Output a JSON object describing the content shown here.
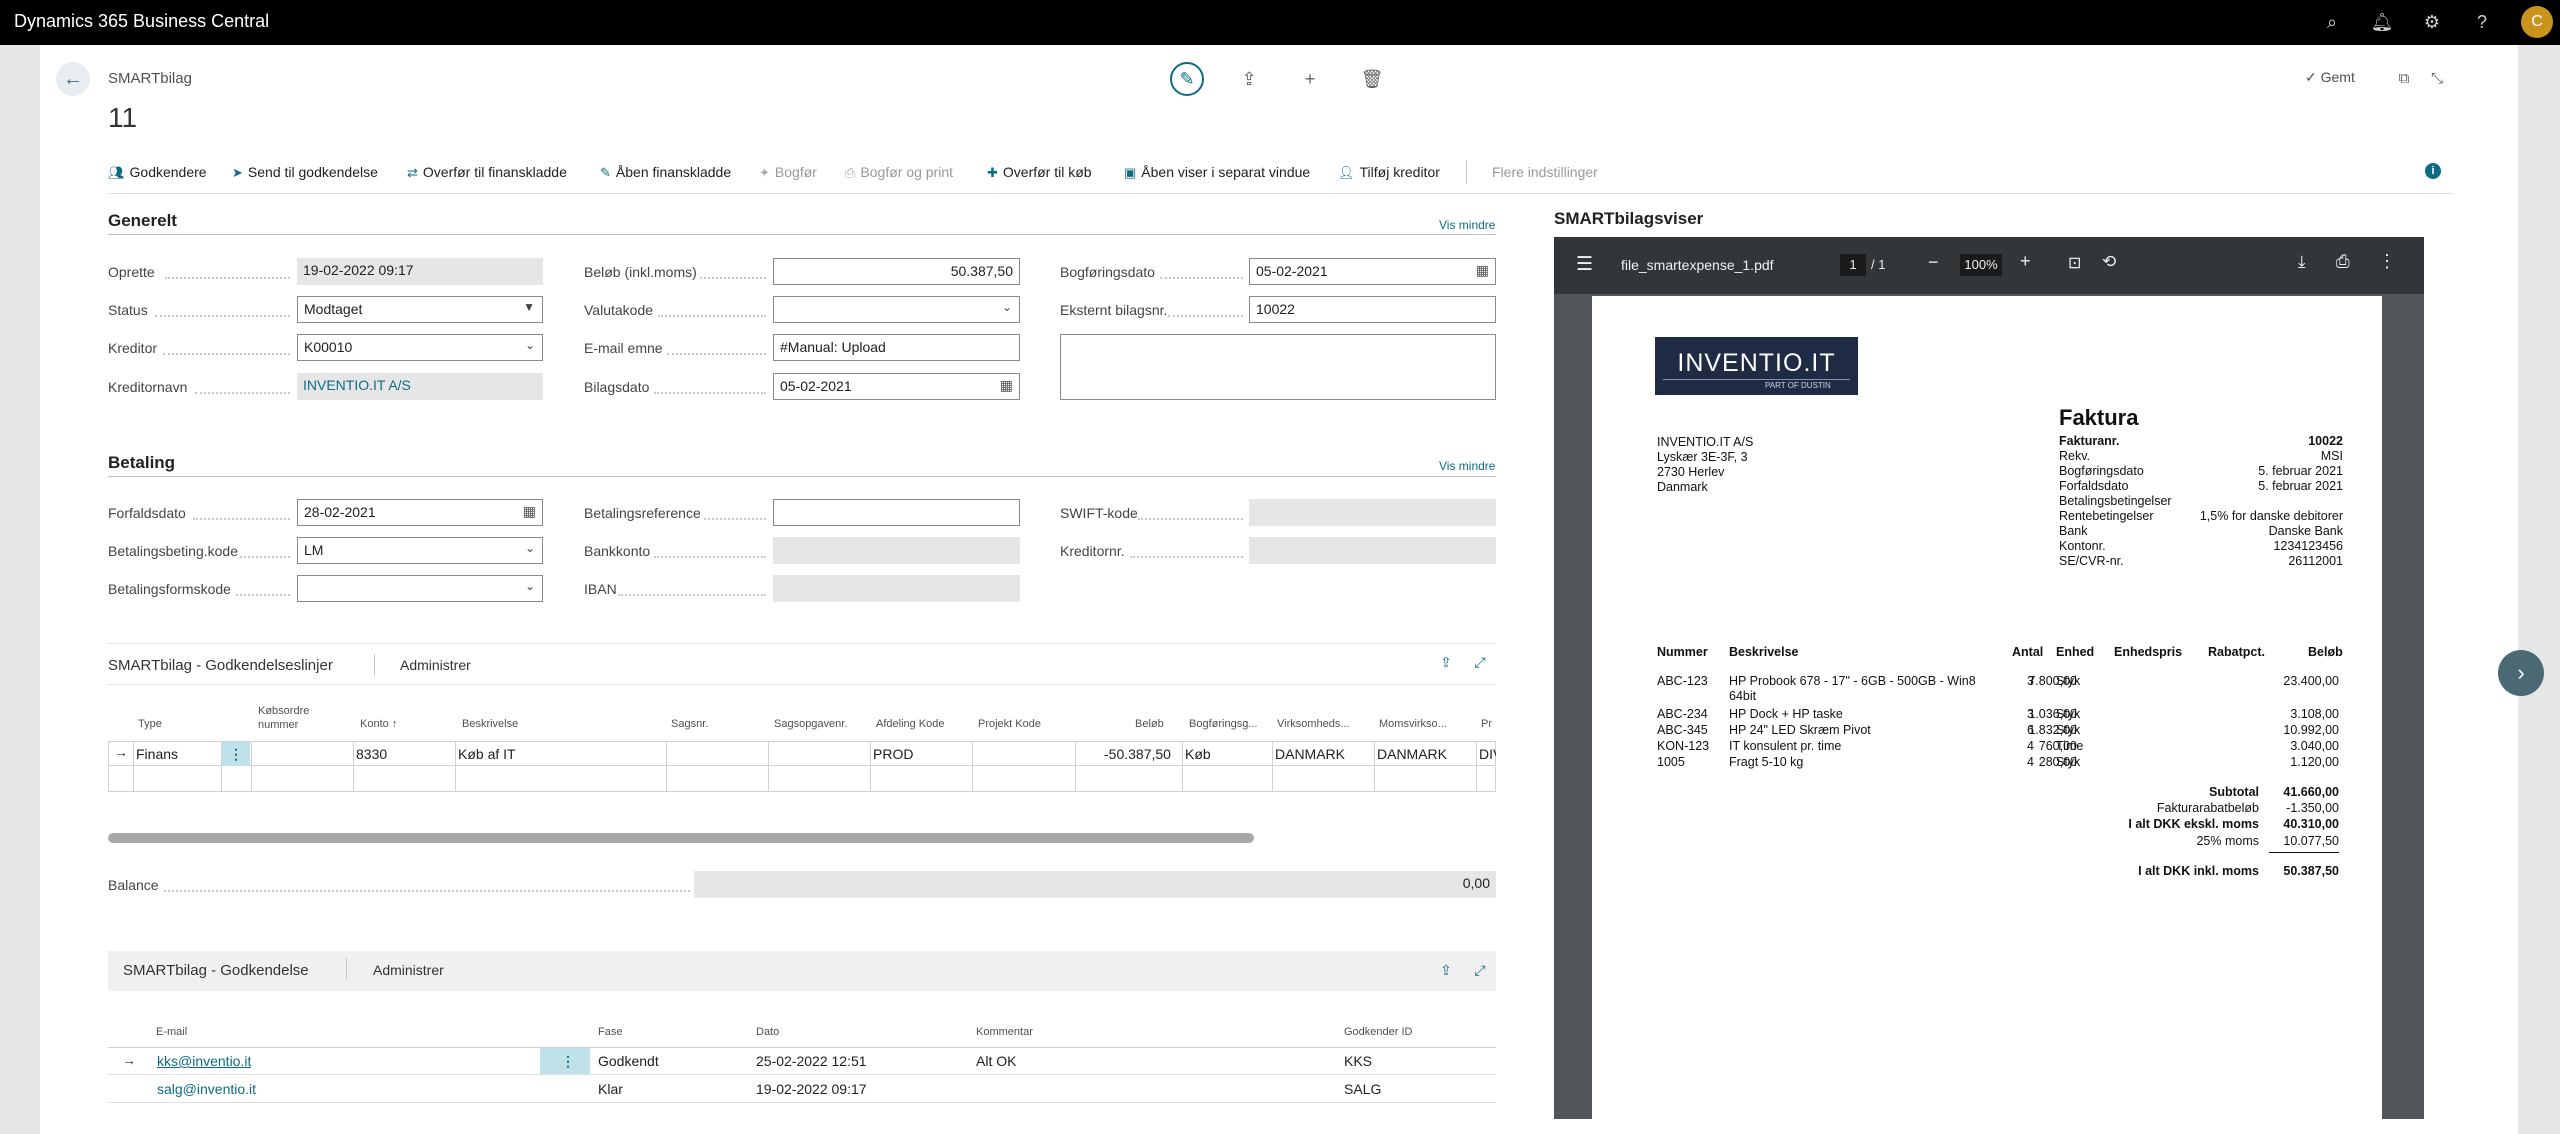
{
  "app": {
    "title": "Dynamics 365 Business Central",
    "avatar": "C",
    "icons": [
      "search-icon",
      "bell-icon",
      "gear-icon",
      "help-icon"
    ]
  },
  "header": {
    "caption": "SMARTbilag",
    "record": "11",
    "saved": "✓ Gemt"
  },
  "actions": [
    "Godkendere",
    "Send til godkendelse",
    "Overfør til finanskladde",
    "Åben finanskladde",
    "Bogfør",
    "Bogfør og print",
    "Overfør til køb",
    "Åben viser i separat vindue",
    "Tilføj kreditor",
    "Flere indstillinger"
  ],
  "generelt": {
    "title": "Generelt",
    "vis_mindre": "Vis mindre",
    "oprette_label": "Oprette",
    "oprette": "19-02-2022 09:17",
    "status_label": "Status",
    "status": "Modtaget",
    "kreditor_label": "Kreditor",
    "kreditor": "K00010",
    "kreditornavn_label": "Kreditornavn",
    "kreditornavn": "INVENTIO.IT A/S",
    "belob_label": "Beløb (inkl.moms)",
    "belob": "50.387,50",
    "valutakode_label": "Valutakode",
    "valutakode": "",
    "email_emne_label": "E-mail emne",
    "email_emne": "#Manual: Upload",
    "bilagsdato_label": "Bilagsdato",
    "bilagsdato": "05-02-2021",
    "bogforingsdato_label": "Bogføringsdato",
    "bogforingsdato": "05-02-2021",
    "eksternt_label": "Eksternt bilagsnr.",
    "eksternt": "10022"
  },
  "betaling": {
    "title": "Betaling",
    "vis_mindre": "Vis mindre",
    "forfaldsdato_label": "Forfaldsdato",
    "forfaldsdato": "28-02-2021",
    "betingelse_label": "Betalingsbeting.kode",
    "betingelse": "LM",
    "betalingsform_label": "Betalingsformskode",
    "betalingsform": "",
    "reference_label": "Betalingsreference",
    "reference": "",
    "bankkonto_label": "Bankkonto",
    "bankkonto": "",
    "iban_label": "IBAN",
    "iban": "",
    "swift_label": "SWIFT-kode",
    "swift": "",
    "kreditornr_label": "Kreditornr.",
    "kreditornr": ""
  },
  "lines": {
    "title": "SMARTbilag - Godkendelseslinjer",
    "manage": "Administrer",
    "headers": [
      "Type",
      "Købsordre nummer",
      "Konto ↑",
      "Beskrivelse",
      "Sagsnr.",
      "Sagsopgavenr.",
      "Afdeling Kode",
      "Projekt Kode",
      "Beløb",
      "Bogføringsg...",
      "Virksomheds...",
      "Momsvirkso...",
      "Pr"
    ],
    "row": [
      "Finans",
      "",
      "8330",
      "Køb af IT",
      "",
      "",
      "PROD",
      "",
      "-50.387,50",
      "Køb",
      "DANMARK",
      "DANMARK",
      "DIV"
    ],
    "balance_label": "Balance",
    "balance": "0,00"
  },
  "approval": {
    "title": "SMARTbilag - Godkendelse",
    "manage": "Administrer",
    "headers": [
      "E-mail",
      "Fase",
      "Dato",
      "Kommentar",
      "Godkender ID"
    ],
    "rows": [
      [
        "kks@inventio.it",
        "Godkendt",
        "25-02-2022 12:51",
        "Alt OK",
        "KKS"
      ],
      [
        "salg@inventio.it",
        "Klar",
        "19-02-2022 09:17",
        "",
        "SALG"
      ]
    ]
  },
  "viewer": {
    "title": "SMARTbilagsviser",
    "file": "file_smartexpense_1.pdf",
    "page": "1",
    "pages": "/  1",
    "zoom": "100%",
    "logo": "INVENTIO.IT",
    "logo_sub": "PART OF DUSTIN",
    "address": [
      "INVENTIO.IT A/S",
      "Lyskær 3E-3F, 3",
      "2730 Herlev",
      "Danmark"
    ],
    "heading": "Faktura",
    "meta": [
      [
        "Fakturanr.",
        "10022"
      ],
      [
        "Rekv.",
        "MSI"
      ],
      [
        "Bogføringsdato",
        "5. februar 2021"
      ],
      [
        "Forfaldsdato",
        "5. februar 2021"
      ],
      [
        "Betalingsbetingelser",
        ""
      ],
      [
        "Rentebetingelser",
        "1,5% for danske debitorer"
      ],
      [
        "Bank",
        "Danske Bank"
      ],
      [
        "Kontonr.",
        "1234123456"
      ],
      [
        "SE/CVR-nr.",
        "26112001"
      ]
    ],
    "cols": [
      "Nummer",
      "Beskrivelse",
      "Antal",
      "Enhed",
      "Enhedspris",
      "Rabatpct.",
      "Beløb"
    ],
    "items": [
      [
        "ABC-123",
        "HP Probook 678 - 17\" - 6GB  - 500GB  - Win8",
        "3",
        "Styk",
        "7.800,00",
        "23.400,00"
      ],
      [
        "ABC-234",
        "HP Dock + HP taske",
        "3",
        "Styk",
        "1.036,00",
        "3.108,00"
      ],
      [
        "ABC-345",
        "HP 24\" LED Skræm Pivot",
        "6",
        "Styk",
        "1.832,00",
        "10.992,00"
      ],
      [
        "KON-123",
        "IT konsulent pr. time",
        "4",
        "Time",
        "760,00",
        "3.040,00"
      ],
      [
        "1005",
        "Fragt 5-10 kg",
        "4",
        "Styk",
        "280,00",
        "1.120,00"
      ]
    ],
    "item1_cont": "64bit",
    "totals": [
      [
        "Subtotal",
        "41.660,00"
      ],
      [
        "Fakturarabatbeløb",
        "-1.350,00"
      ],
      [
        "I alt DKK ekskl. moms",
        "40.310,00"
      ],
      [
        "25% moms",
        "10.077,50"
      ],
      [
        "I alt DKK inkl. moms",
        "50.387,50"
      ]
    ]
  }
}
